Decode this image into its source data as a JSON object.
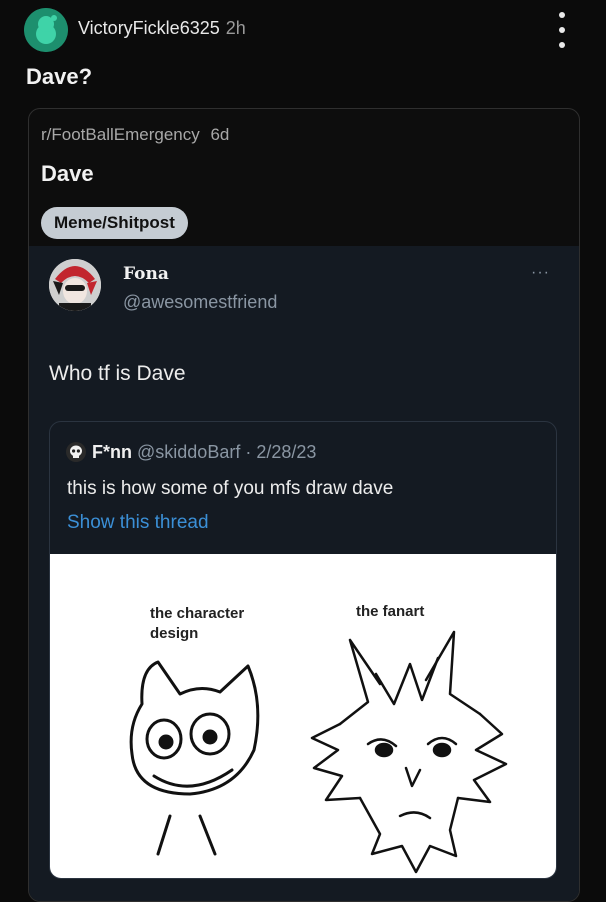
{
  "header": {
    "username": "VictoryFickle6325",
    "age": "2h",
    "avatar_icon": "reddit-snoo-avatar-icon",
    "menu_icon": "kebab-menu-icon"
  },
  "post": {
    "title": "Dave?"
  },
  "crosspost": {
    "subreddit": "r/FootBallEmergency",
    "age": "6d",
    "title": "Dave",
    "flair": "Meme/Shitpost"
  },
  "tweet": {
    "name": "Fona",
    "handle": "@awesomestfriend",
    "more": "···",
    "text": "Who tf is Dave",
    "quote": {
      "name": "F*nn",
      "handle": "@skiddoBarf",
      "date": "· 2/28/23",
      "text": "this is how some of you mfs draw dave",
      "link": "Show this thread",
      "image": {
        "left_caption": "the character design",
        "right_caption": "the fanart"
      }
    }
  },
  "colors": {
    "background": "#0b0b0b",
    "tweet_background": "#141a22",
    "link": "#3b8fd6",
    "flair": "#c5ccd3"
  }
}
